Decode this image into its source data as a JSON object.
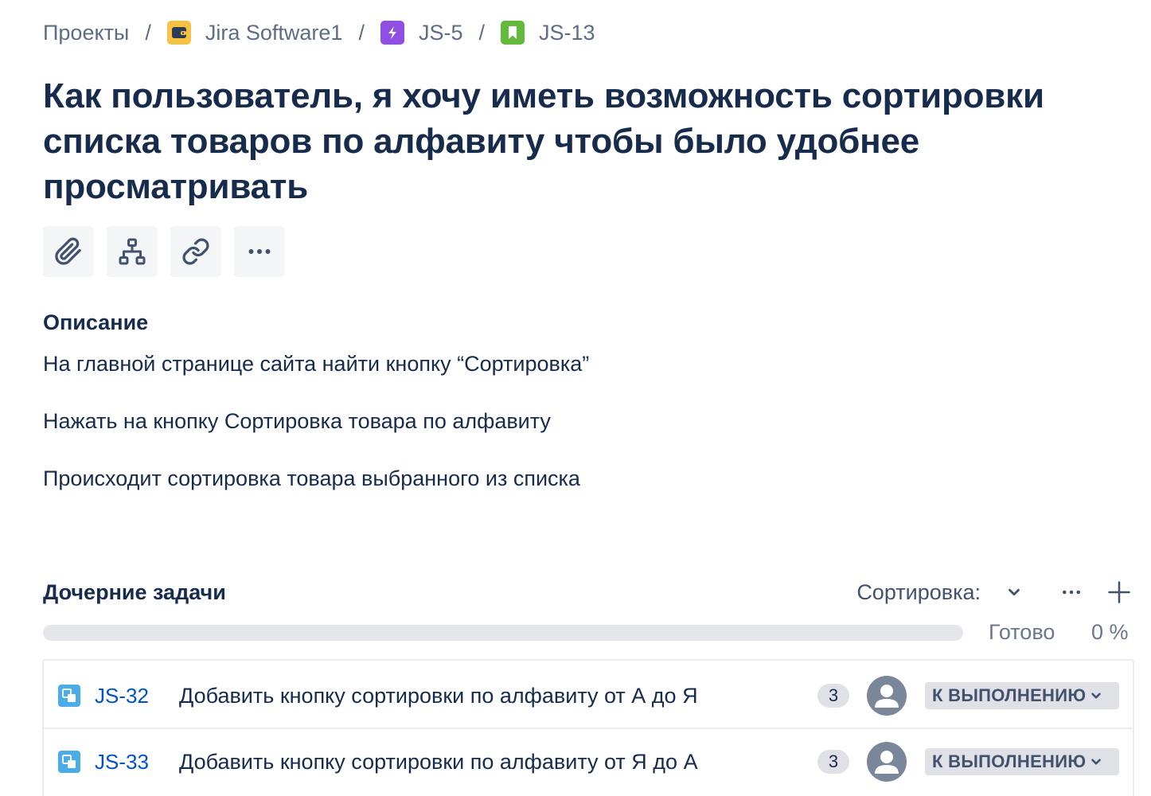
{
  "breadcrumbs": {
    "projects": "Проекты",
    "project": "Jira Software1",
    "epic": "JS-5",
    "issue": "JS-13",
    "separator": "/"
  },
  "issue": {
    "title": "Как пользователь, я хочу иметь возможность сортировки списка товаров по алфавиту чтобы было удобнее просматривать"
  },
  "toolbar": {
    "icons": [
      "paperclip-icon",
      "hierarchy-icon",
      "link-icon",
      "more-icon"
    ]
  },
  "description": {
    "label": "Описание",
    "paragraphs": [
      "На главной странице сайта найти кнопку “Сортировка”",
      "Нажать на кнопку Сортировка товара по алфавиту",
      "Происходит сортировка товара выбранного из списка"
    ]
  },
  "child_tasks": {
    "title": "Дочерние задачи",
    "sort_label": "Сортировка:",
    "done_label": "Готово",
    "done_percent": "0 %",
    "progress_fraction": 0,
    "colors": {
      "key": "#0052CC",
      "task_icon": "#4BADE8",
      "status_bg": "#DFE1E6"
    },
    "items": [
      {
        "key": "JS-32",
        "summary": "Добавить кнопку сортировки по алфавиту от А до Я",
        "points": "3",
        "status": "К ВЫПОЛНЕНИЮ"
      },
      {
        "key": "JS-33",
        "summary": "Добавить кнопку сортировки по алфавиту от Я до А",
        "points": "3",
        "status": "К ВЫПОЛНЕНИЮ"
      }
    ]
  }
}
